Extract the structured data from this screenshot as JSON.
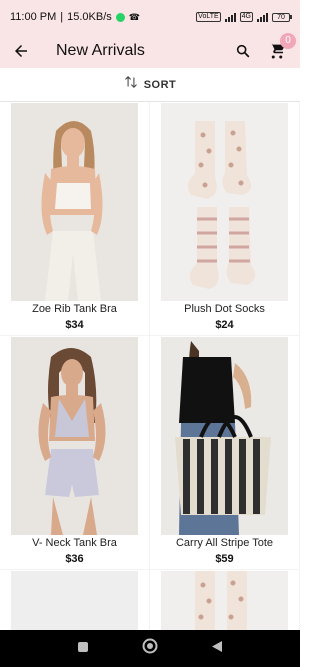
{
  "status_bar": {
    "time": "11:00 PM",
    "network_speed": "15.0KB/s",
    "battery": "70",
    "icons": [
      "whatsapp-icon",
      "call-icon",
      "volte-icon",
      "signal-icon",
      "wifi-icon",
      "battery-icon"
    ]
  },
  "app_bar": {
    "title": "New Arrivals",
    "cart_count": "0",
    "icons": [
      "back-arrow-icon",
      "search-icon",
      "cart-icon"
    ]
  },
  "sort": {
    "label": "SORT",
    "icon": "sort-arrows-icon"
  },
  "products": [
    {
      "name": "Zoe Rib Tank Bra",
      "price": "$34"
    },
    {
      "name": "Plush Dot Socks",
      "price": "$24"
    },
    {
      "name": "V- Neck Tank Bra",
      "price": "$36"
    },
    {
      "name": "Carry All Stripe Tote",
      "price": "$59"
    },
    {
      "name": "",
      "price": ""
    },
    {
      "name": "",
      "price": ""
    }
  ],
  "nav_bar": {
    "icons": [
      "recents-icon",
      "home-icon",
      "back-icon"
    ]
  },
  "colors": {
    "header_bg": "#f9e4e6",
    "badge": "#f2a7b8",
    "nav_bg": "#000000"
  }
}
